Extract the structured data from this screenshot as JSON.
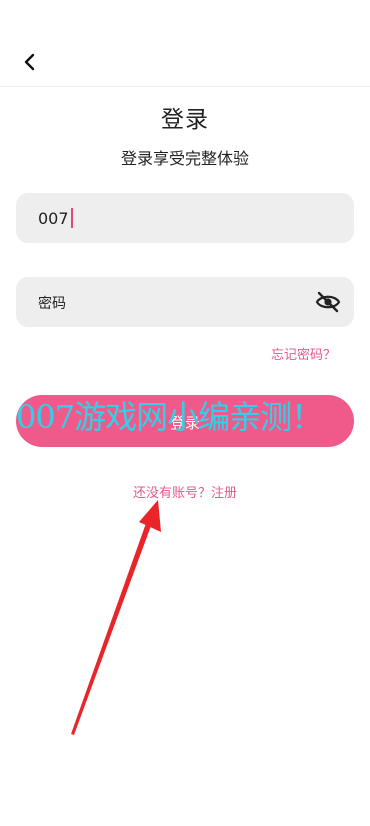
{
  "header": {
    "back_icon": "chevron-left-icon"
  },
  "login": {
    "title": "登录",
    "subtitle": "登录享受完整体验",
    "account_value": "007",
    "password_placeholder": "密码",
    "eye_icon": "eye-off-icon",
    "forgot_label": "忘记密码？",
    "login_button_label": "登录",
    "register_label": "还没有账号？注册"
  },
  "overlay": {
    "watermark": "007游戏网小编亲测！",
    "arrow_color": "#e8262a"
  },
  "colors": {
    "accent": "#f05a8a",
    "link": "#e8588c",
    "field_bg": "#eeeeee",
    "watermark": "#2fd1e8"
  }
}
